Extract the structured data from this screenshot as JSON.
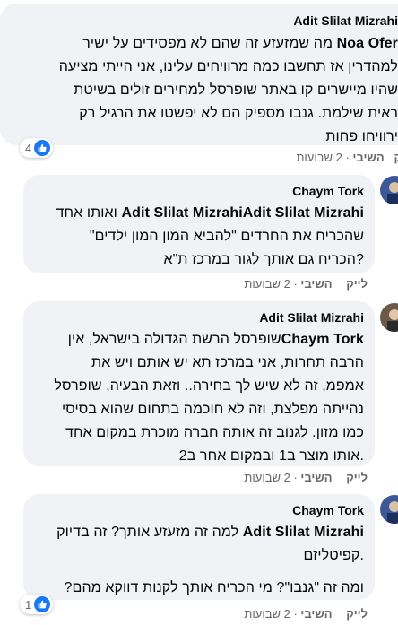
{
  "actions": {
    "like": "לייק",
    "reply": "השיבי",
    "separator": "·"
  },
  "comments": [
    {
      "author": "Adit Slilat Mizrahi",
      "tag": "Noa Ofer",
      "lines": [
        "מה שמזעזע זה שהם לא מפסידים על ישיר",
        "למהדרין אז תחשבו כמה מרוויחים עלינו, אני הייתי מציעה",
        "שהיו מיישרים קו באתר שופרסל למחירים זולים בשיטת",
        "ראית שילמת. גנבו מספיק הם לא יפשטו את הרגיל רק",
        "ירוויחו פחות"
      ],
      "time": "2 שבועות",
      "reactions": "4"
    },
    {
      "author": "Chaym Tork",
      "tag": "Adit Slilat MizrahiAdit Slilat Mizrahi",
      "lines": [
        "ואותו אחד",
        "שהכריח את החרדים \"להביא המון המון ילדים\"",
        "?הכריח גם אותך לגור במרכז ת\"א"
      ],
      "time": "2 שבועות"
    },
    {
      "author": "Adit Slilat Mizrahi",
      "tag": "Chaym Tork",
      "lines": [
        "שופרסל הרשת הגדולה בישראל, אין",
        "הרבה תחרות, אני במרכז תא יש אותם ויש את",
        "אמפמ, זה לא שיש לך בחירה.. וזאת הבעיה, שופרסל",
        "נהייתה מפלצת, וזה לא חוכמה בתחום שהוא בסיסי",
        "כמו מזון. לגנוב זה אותה חברה מוכרת במקום אחד",
        ".אותו מוצר ב1 ובמקום אחר ב2"
      ],
      "time": "2 שבועות"
    },
    {
      "author": "Chaym Tork",
      "tag": "Adit Slilat Mizrahi",
      "lines": [
        "למה זה מזעזע אותך? זה בדיוק",
        ".קפיטליזם",
        "",
        "ומה זה \"גנבו\"? מי הכריח אותך לקנות דווקא מהם?"
      ],
      "time": "2 שבועות",
      "reactions": "1"
    }
  ],
  "colors": {
    "bubble": "#f0f2f5",
    "meta": "#65676b",
    "like_blue": "#1877f2"
  }
}
